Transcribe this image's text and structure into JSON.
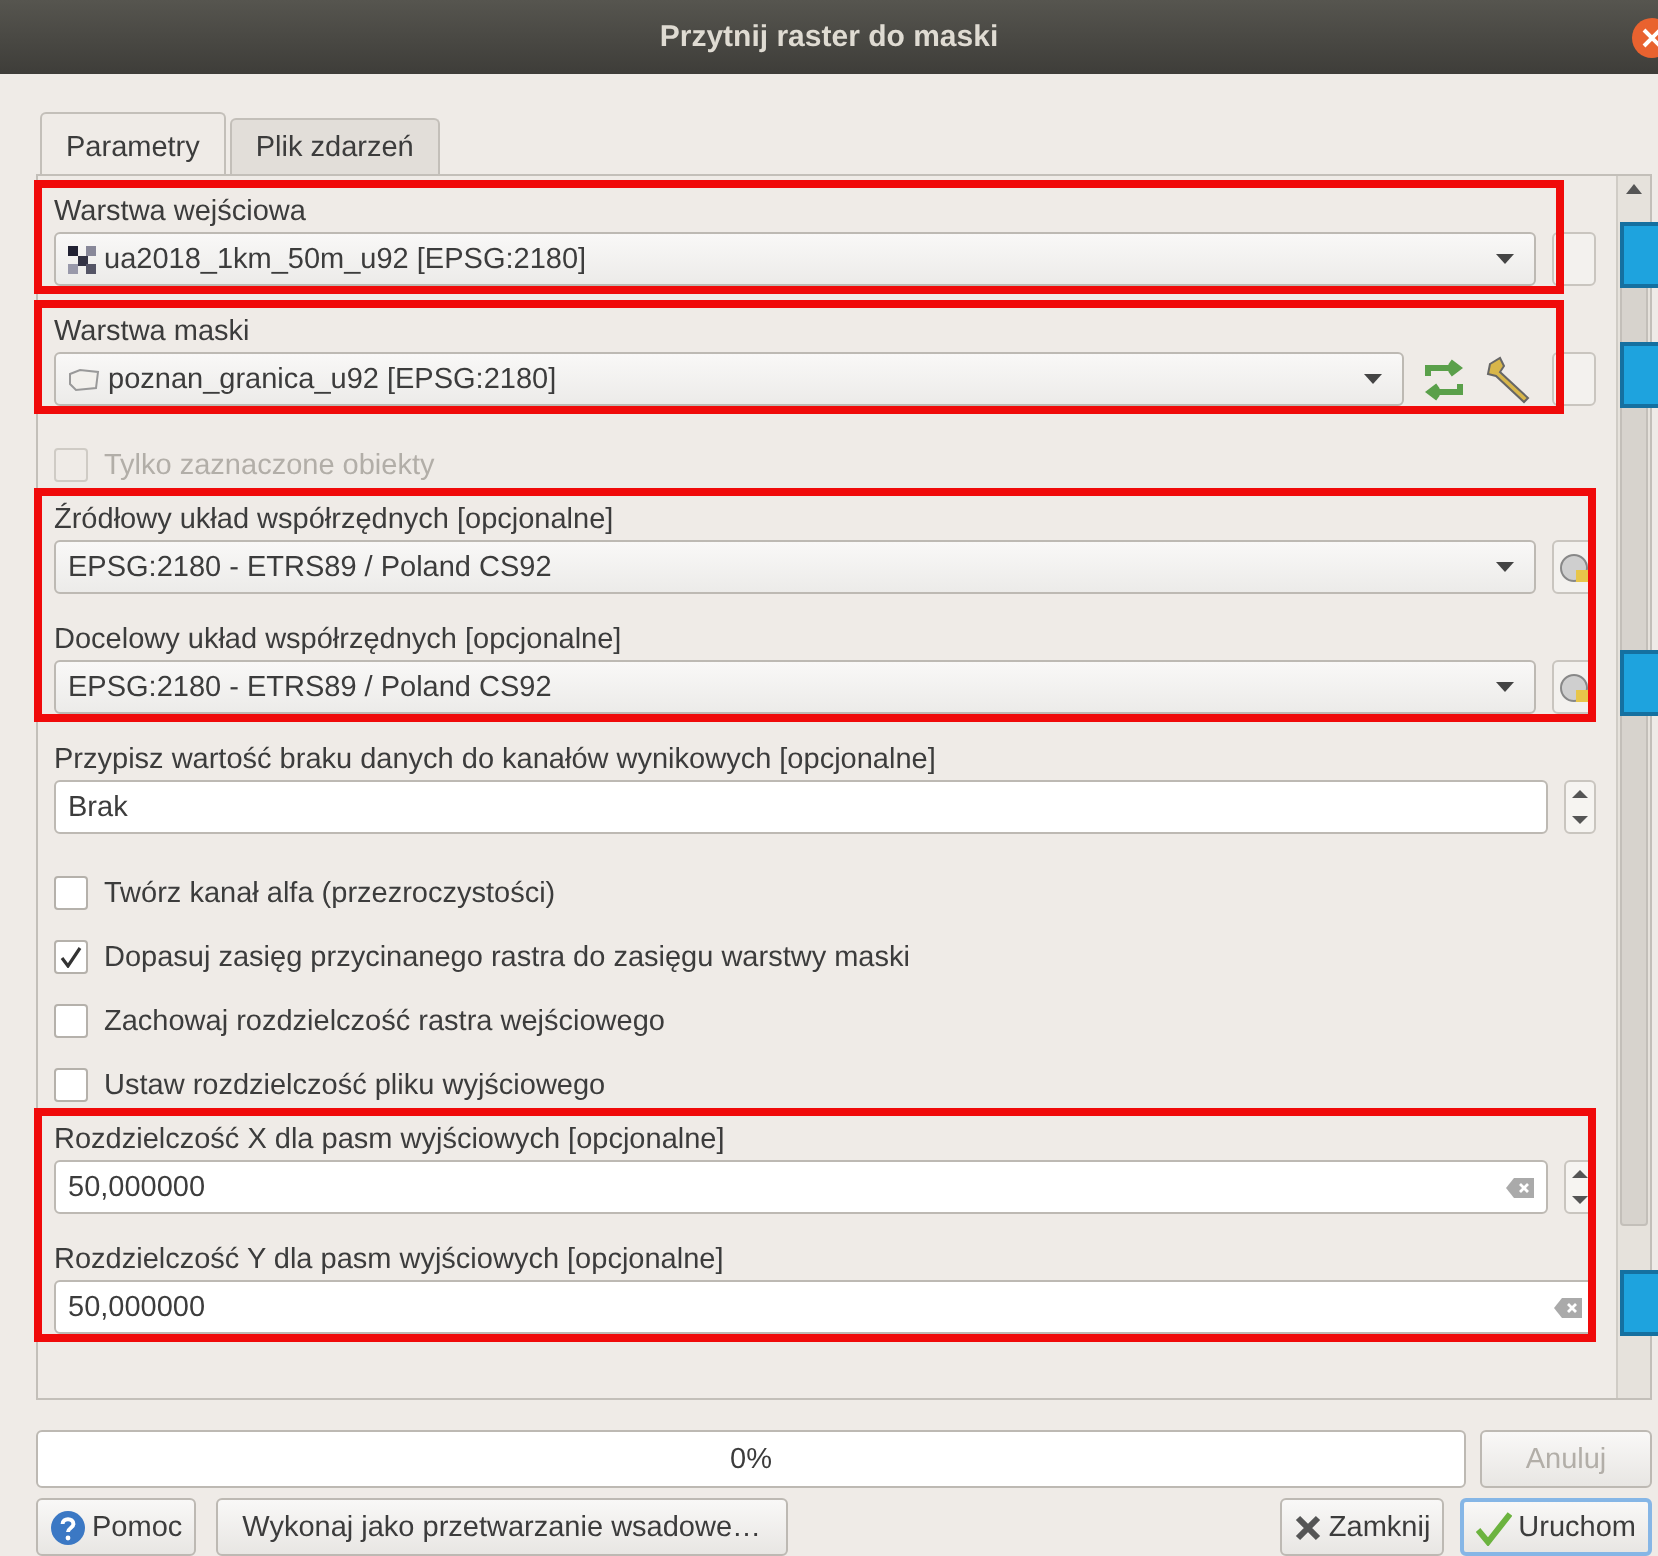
{
  "window": {
    "title": "Przytnij raster do maski"
  },
  "tabs": [
    {
      "label": "Parametry",
      "selected": true
    },
    {
      "label": "Plik zdarzeń",
      "selected": false
    }
  ],
  "groups": [
    {
      "highlighted": true,
      "items": [
        {
          "kind": "layer",
          "label": "Warstwa wejściowa",
          "value": "ua2018_1km_50m_u92 [EPSG:2180]",
          "raster": true,
          "flagged": true
        }
      ]
    },
    {
      "highlighted": true,
      "items": [
        {
          "kind": "layer",
          "label": "Warstwa maski",
          "value": "poznan_granica_u92 [EPSG:2180]",
          "raster": false,
          "tools": true,
          "flagged": true
        }
      ]
    },
    {
      "items": [
        {
          "kind": "checkbox",
          "label": "Tylko zaznaczone obiekty",
          "checked": false,
          "disabled": true
        }
      ]
    },
    {
      "highlighted": true,
      "items": [
        {
          "kind": "crs",
          "label": "Źródłowy układ współrzędnych [opcjonalne]",
          "value": "EPSG:2180 - ETRS89 / Poland CS92"
        },
        {
          "kind": "crs",
          "label": "Docelowy układ współrzędnych [opcjonalne]",
          "value": "EPSG:2180 - ETRS89 / Poland CS92",
          "flagged": true
        }
      ]
    },
    {
      "items": [
        {
          "kind": "spin",
          "label": "Przypisz wartość braku danych do kanałów wynikowych [opcjonalne]",
          "value": "Brak"
        },
        {
          "kind": "checkbox",
          "label": "Twórz kanał alfa (przezroczystości)",
          "checked": false,
          "disabled": false
        },
        {
          "kind": "checkbox",
          "label": "Dopasuj zasięg przycinanego rastra do zasięgu warstwy maski",
          "checked": true,
          "disabled": false
        },
        {
          "kind": "checkbox",
          "label": "Zachowaj rozdzielczość rastra wejściowego",
          "checked": false,
          "disabled": false
        },
        {
          "kind": "checkbox",
          "label": "Ustaw rozdzielczość pliku wyjściowego",
          "checked": false,
          "disabled": false
        }
      ]
    },
    {
      "highlighted": true,
      "items": [
        {
          "kind": "number",
          "label": "Rozdzielczość X dla pasm wyjściowych [opcjonalne]",
          "value": "50,000000"
        },
        {
          "kind": "number",
          "label": "Rozdzielczość Y dla pasm wyjściowych [opcjonalne]",
          "value": "50,000000",
          "flagged": true
        }
      ]
    }
  ],
  "progress": {
    "level": 0,
    "text": "0%"
  },
  "cancel_button": {
    "label": "Anuluj",
    "disabled": true
  },
  "buttons": [
    {
      "kind": "help",
      "label": "Pomoc"
    },
    {
      "kind": "batch",
      "label": "Wykonaj jako przetwarzanie wsadowe…"
    },
    {
      "kind": "close",
      "label": "Zamknij"
    },
    {
      "kind": "run",
      "label": "Uruchom"
    }
  ]
}
